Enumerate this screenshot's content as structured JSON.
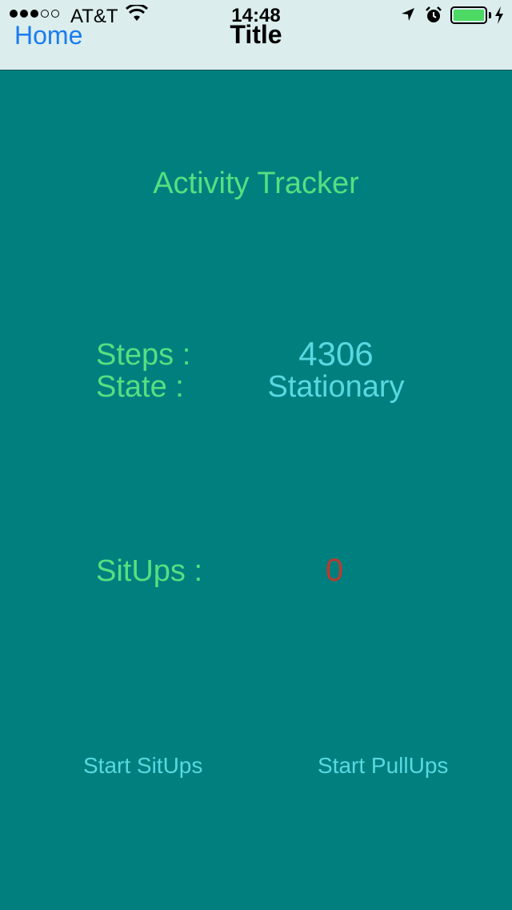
{
  "status_bar": {
    "carrier": "AT&T",
    "time": "14:48",
    "signal_bars_filled": 3,
    "signal_bars_total": 5,
    "battery_level_fraction": 0.9,
    "icons": [
      "signal-dots-icon",
      "wifi-icon",
      "location-arrow-icon",
      "alarm-icon",
      "battery-icon",
      "charging-bolt-icon"
    ]
  },
  "nav": {
    "back_label": "Home",
    "title": "Title"
  },
  "main": {
    "heading": "Activity Tracker",
    "steps_label": "Steps :",
    "steps_value": "4306",
    "state_label": "State :",
    "state_value": "Stationary",
    "situps_label": "SitUps :",
    "situps_value": "0"
  },
  "buttons": {
    "start_situps": "Start SitUps",
    "start_pullups": "Start PullUps"
  },
  "colors": {
    "background": "#007f7f",
    "nav_background": "#dbeded",
    "label_green": "#54e080",
    "value_cyan": "#5ad8e0",
    "situps_red": "#c0392b",
    "link_blue": "#1a7cf0"
  }
}
